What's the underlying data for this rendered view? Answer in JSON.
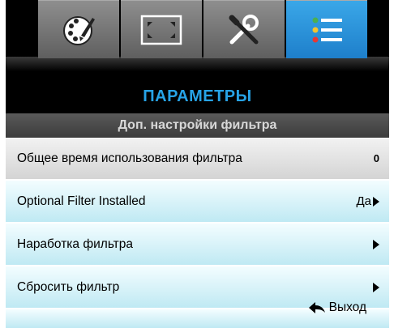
{
  "tabs": [
    {
      "name": "image",
      "icon": "palette-icon",
      "active": false
    },
    {
      "name": "display",
      "icon": "screen-aspect-icon",
      "active": false
    },
    {
      "name": "setup",
      "icon": "tools-icon",
      "active": false
    },
    {
      "name": "options",
      "icon": "list-menu-icon",
      "active": true
    }
  ],
  "header": {
    "title": "ПАРАМЕТРЫ",
    "subtitle": "Доп. настройки фильтра"
  },
  "menu": {
    "items": [
      {
        "label": "Общее время использования фильтра",
        "value": "0",
        "arrow": false,
        "selected": true
      },
      {
        "label": "Optional Filter Installed",
        "value": "Да",
        "arrow": true,
        "selected": false
      },
      {
        "label": "Наработка фильтра",
        "value": "",
        "arrow": true,
        "selected": false
      },
      {
        "label": "Сбросить фильтр",
        "value": "",
        "arrow": true,
        "selected": false
      }
    ]
  },
  "footer": {
    "exit_label": "Выход",
    "exit_icon": "return-arrow-icon"
  },
  "colors": {
    "accent": "#27a3e6",
    "active_tab": "#2b90d9",
    "row_gradient_top": "#f3fdff",
    "row_gradient_bottom": "#bfe9f3"
  }
}
